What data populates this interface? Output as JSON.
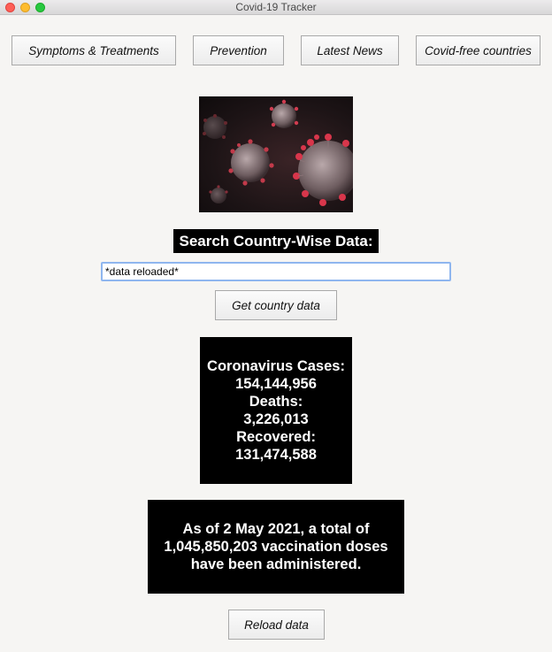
{
  "window": {
    "title": "Covid-19 Tracker"
  },
  "nav": {
    "symptoms": "Symptoms & Treatments",
    "prevention": "Prevention",
    "news": "Latest News",
    "covid_free": "Covid-free countries"
  },
  "search": {
    "title": "Search Country-Wise Data:",
    "value": "*data reloaded*",
    "button": "Get country data"
  },
  "stats": {
    "cases_label": "Coronavirus Cases:",
    "cases": "154,144,956",
    "deaths_label": "Deaths:",
    "deaths": "3,226,013",
    "recovered_label": "Recovered:",
    "recovered": "131,474,588"
  },
  "vaccination": {
    "text": "As of 2 May 2021, a total of 1,045,850,203 vaccination doses have been administered."
  },
  "footer": {
    "reload": "Reload data"
  }
}
